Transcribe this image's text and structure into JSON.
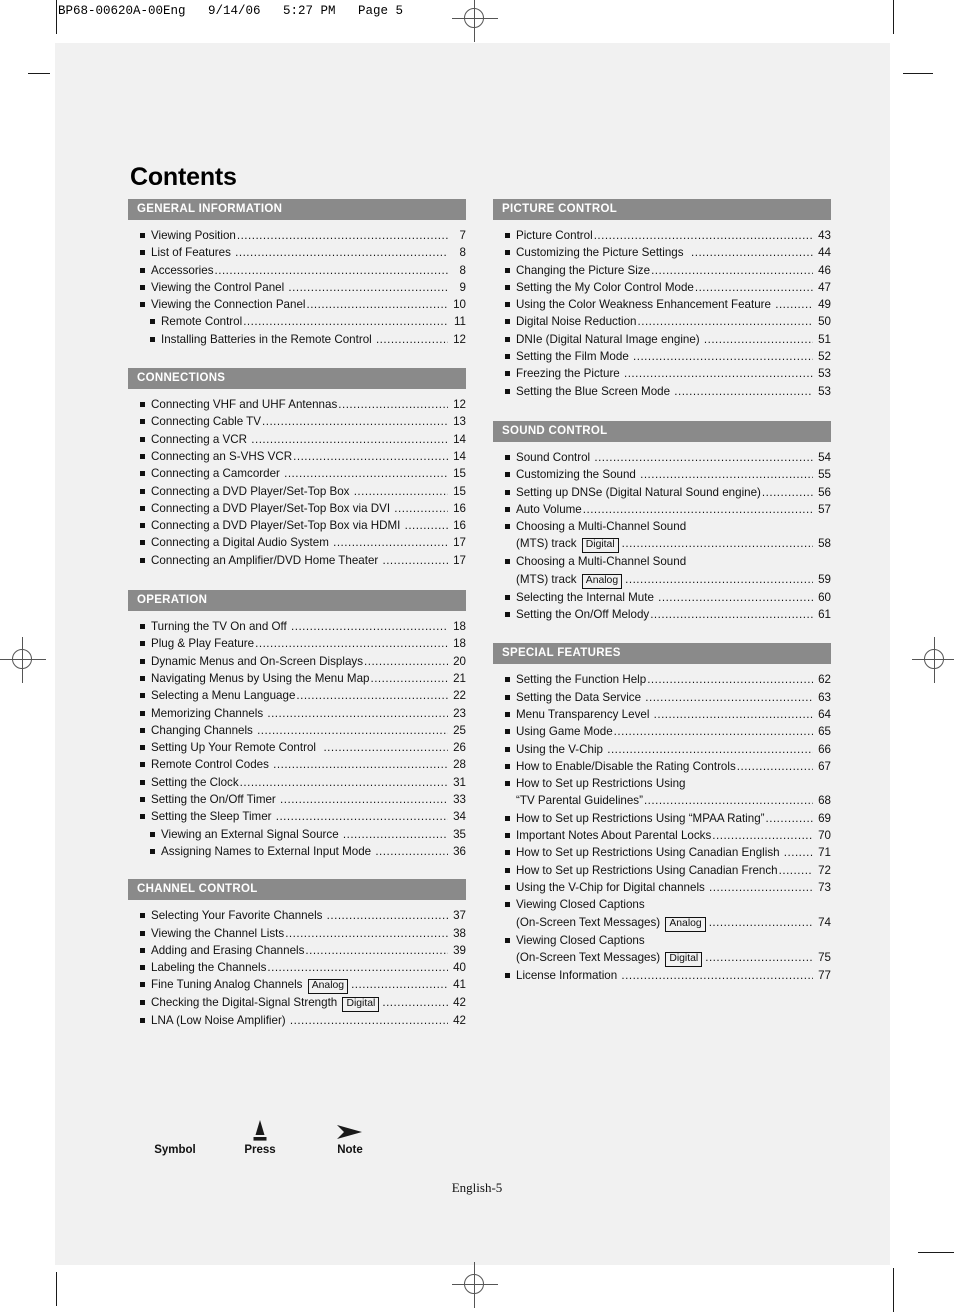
{
  "slug": "BP68-00620A-00Eng   9/14/06   5:27 PM   Page 5",
  "title": "Contents",
  "footer": {
    "page_label": "English-5"
  },
  "legend": {
    "symbol_label": "Symbol",
    "press_label": "Press",
    "note_label": "Note",
    "press_icon": "press-button-triangle-icon",
    "note_icon": "note-arrow-icon"
  },
  "colors": {
    "section_header_bg": "#8a8a8a",
    "section_header_text": "#ffffff",
    "page_bg": "#f1f1f1",
    "text": "#111111"
  },
  "left_column": [
    {
      "header": "GENERAL INFORMATION",
      "entries": [
        {
          "lines": [
            {
              "text": "Viewing Position"
            }
          ],
          "page": "7"
        },
        {
          "lines": [
            {
              "text": "List of Features "
            }
          ],
          "page": "8"
        },
        {
          "lines": [
            {
              "text": "Accessories"
            }
          ],
          "page": "8"
        },
        {
          "lines": [
            {
              "text": "Viewing the Control Panel "
            }
          ],
          "page": "9"
        },
        {
          "lines": [
            {
              "text": "Viewing the Connection Panel"
            }
          ],
          "page": "10"
        },
        {
          "lines": [
            {
              "text": "Remote Control"
            }
          ],
          "page": "11",
          "indent": true
        },
        {
          "lines": [
            {
              "text": "Installing Batteries in the Remote Control "
            }
          ],
          "page": "12",
          "indent": true
        }
      ]
    },
    {
      "header": "CONNECTIONS",
      "entries": [
        {
          "lines": [
            {
              "text": "Connecting VHF and UHF Antennas"
            }
          ],
          "page": "12"
        },
        {
          "lines": [
            {
              "text": "Connecting Cable TV"
            }
          ],
          "page": "13"
        },
        {
          "lines": [
            {
              "text": "Connecting a VCR "
            }
          ],
          "page": "14"
        },
        {
          "lines": [
            {
              "text": "Connecting an S-VHS VCR"
            }
          ],
          "page": "14"
        },
        {
          "lines": [
            {
              "text": "Connecting a Camcorder "
            }
          ],
          "page": "15"
        },
        {
          "lines": [
            {
              "text": "Connecting a DVD Player/Set-Top Box "
            }
          ],
          "page": "15"
        },
        {
          "lines": [
            {
              "text": "Connecting a DVD Player/Set-Top Box via DVI "
            }
          ],
          "page": "16"
        },
        {
          "lines": [
            {
              "text": "Connecting a DVD Player/Set-Top Box via HDMI "
            }
          ],
          "page": "16"
        },
        {
          "lines": [
            {
              "text": "Connecting a Digital Audio System "
            }
          ],
          "page": "17"
        },
        {
          "lines": [
            {
              "text": "Connecting an Amplifier/DVD Home Theater "
            }
          ],
          "page": "17"
        }
      ]
    },
    {
      "header": "OPERATION",
      "entries": [
        {
          "lines": [
            {
              "text": "Turning the TV On and Off "
            }
          ],
          "page": "18"
        },
        {
          "lines": [
            {
              "text": "Plug & Play Feature"
            }
          ],
          "page": "18"
        },
        {
          "lines": [
            {
              "text": "Dynamic Menus and On-Screen Displays"
            }
          ],
          "page": "20"
        },
        {
          "lines": [
            {
              "text": "Navigating Menus by Using the Menu Map"
            }
          ],
          "page": "21"
        },
        {
          "lines": [
            {
              "text": "Selecting a Menu Language"
            }
          ],
          "page": "22"
        },
        {
          "lines": [
            {
              "text": "Memorizing Channels "
            }
          ],
          "page": "23"
        },
        {
          "lines": [
            {
              "text": "Changing Channels "
            }
          ],
          "page": "25"
        },
        {
          "lines": [
            {
              "text": "Setting Up Your Remote Control  "
            }
          ],
          "page": "26"
        },
        {
          "lines": [
            {
              "text": "Remote Control Codes "
            }
          ],
          "page": "28"
        },
        {
          "lines": [
            {
              "text": "Setting the Clock"
            }
          ],
          "page": "31"
        },
        {
          "lines": [
            {
              "text": "Setting the On/Off Timer "
            }
          ],
          "page": "33"
        },
        {
          "lines": [
            {
              "text": "Setting the Sleep Timer "
            }
          ],
          "page": "34"
        },
        {
          "lines": [
            {
              "text": "Viewing an External Signal Source "
            }
          ],
          "page": "35",
          "indent": true
        },
        {
          "lines": [
            {
              "text": "Assigning Names to External Input Mode "
            }
          ],
          "page": "36",
          "indent": true
        }
      ]
    },
    {
      "header": "CHANNEL CONTROL",
      "entries": [
        {
          "lines": [
            {
              "text": "Selecting Your Favorite Channels "
            }
          ],
          "page": "37"
        },
        {
          "lines": [
            {
              "text": "Viewing the Channel Lists"
            }
          ],
          "page": "38"
        },
        {
          "lines": [
            {
              "text": "Adding and Erasing Channels"
            }
          ],
          "page": "39"
        },
        {
          "lines": [
            {
              "text": "Labeling the Channels"
            }
          ],
          "page": "40"
        },
        {
          "lines": [
            {
              "text": "Fine Tuning Analog Channels ",
              "badge": "Analog"
            }
          ],
          "page": "41"
        },
        {
          "lines": [
            {
              "text": "Checking the Digital-Signal Strength ",
              "badge": "Digital"
            }
          ],
          "page": "42"
        },
        {
          "lines": [
            {
              "text": "LNA (Low Noise Amplifier) "
            }
          ],
          "page": "42"
        }
      ]
    }
  ],
  "right_column": [
    {
      "header": "PICTURE CONTROL",
      "entries": [
        {
          "lines": [
            {
              "text": "Picture Control"
            }
          ],
          "page": "43"
        },
        {
          "lines": [
            {
              "text": "Customizing the Picture Settings  "
            }
          ],
          "page": "44"
        },
        {
          "lines": [
            {
              "text": "Changing the Picture Size"
            }
          ],
          "page": "46"
        },
        {
          "lines": [
            {
              "text": "Setting the My Color Control Mode"
            }
          ],
          "page": "47"
        },
        {
          "lines": [
            {
              "text": "Using the Color Weakness Enhancement Feature "
            }
          ],
          "page": "49"
        },
        {
          "lines": [
            {
              "text": "Digital Noise Reduction"
            }
          ],
          "page": "50"
        },
        {
          "lines": [
            {
              "text": "DNIe (Digital Natural Image engine) "
            }
          ],
          "page": "51"
        },
        {
          "lines": [
            {
              "text": "Setting the Film Mode "
            }
          ],
          "page": "52"
        },
        {
          "lines": [
            {
              "text": "Freezing the Picture "
            }
          ],
          "page": "53"
        },
        {
          "lines": [
            {
              "text": "Setting the Blue Screen Mode "
            }
          ],
          "page": "53"
        }
      ]
    },
    {
      "header": "SOUND CONTROL",
      "entries": [
        {
          "lines": [
            {
              "text": "Sound Control "
            }
          ],
          "page": "54"
        },
        {
          "lines": [
            {
              "text": "Customizing the Sound "
            }
          ],
          "page": "55"
        },
        {
          "lines": [
            {
              "text": "Setting up DNSe (Digital Natural Sound engine)"
            }
          ],
          "page": "56"
        },
        {
          "lines": [
            {
              "text": "Auto Volume"
            }
          ],
          "page": "57"
        },
        {
          "lines": [
            {
              "text": "Choosing a Multi-Channel Sound",
              "nodots": true
            },
            {
              "text": "(MTS) track ",
              "badge": "Digital"
            }
          ],
          "page": "58"
        },
        {
          "lines": [
            {
              "text": "Choosing a Multi-Channel Sound",
              "nodots": true
            },
            {
              "text": "(MTS) track ",
              "badge": "Analog"
            }
          ],
          "page": "59"
        },
        {
          "lines": [
            {
              "text": "Selecting the Internal Mute "
            }
          ],
          "page": "60"
        },
        {
          "lines": [
            {
              "text": "Setting the On/Off Melody"
            }
          ],
          "page": "61"
        }
      ]
    },
    {
      "header": "SPECIAL FEATURES",
      "entries": [
        {
          "lines": [
            {
              "text": "Setting the Function Help"
            }
          ],
          "page": "62"
        },
        {
          "lines": [
            {
              "text": "Setting the Data Service "
            }
          ],
          "page": "63"
        },
        {
          "lines": [
            {
              "text": "Menu Transparency Level "
            }
          ],
          "page": "64"
        },
        {
          "lines": [
            {
              "text": "Using Game Mode"
            }
          ],
          "page": "65"
        },
        {
          "lines": [
            {
              "text": "Using the V-Chip "
            }
          ],
          "page": "66"
        },
        {
          "lines": [
            {
              "text": "How to Enable/Disable the Rating Controls"
            }
          ],
          "page": "67"
        },
        {
          "lines": [
            {
              "text": "How to Set up Restrictions Using",
              "nodots": true
            },
            {
              "text": "“TV Parental Guidelines”"
            }
          ],
          "page": "68"
        },
        {
          "lines": [
            {
              "text": "How to Set up Restrictions Using “MPAA Rating”"
            }
          ],
          "page": "69"
        },
        {
          "lines": [
            {
              "text": "Important Notes About Parental Locks"
            }
          ],
          "page": "70"
        },
        {
          "lines": [
            {
              "text": "How to Set up Restrictions Using Canadian English "
            }
          ],
          "page": "71"
        },
        {
          "lines": [
            {
              "text": "How to Set up Restrictions Using Canadian French"
            }
          ],
          "page": "72"
        },
        {
          "lines": [
            {
              "text": "Using the V-Chip for Digital channels "
            }
          ],
          "page": "73"
        },
        {
          "lines": [
            {
              "text": "Viewing Closed Captions",
              "nodots": true
            },
            {
              "text": "(On-Screen Text Messages) ",
              "badge": "Analog"
            }
          ],
          "page": "74"
        },
        {
          "lines": [
            {
              "text": "Viewing Closed Captions",
              "nodots": true
            },
            {
              "text": "(On-Screen Text Messages) ",
              "badge": "Digital"
            }
          ],
          "page": "75"
        },
        {
          "lines": [
            {
              "text": "License Information "
            }
          ],
          "page": "77"
        }
      ]
    }
  ]
}
